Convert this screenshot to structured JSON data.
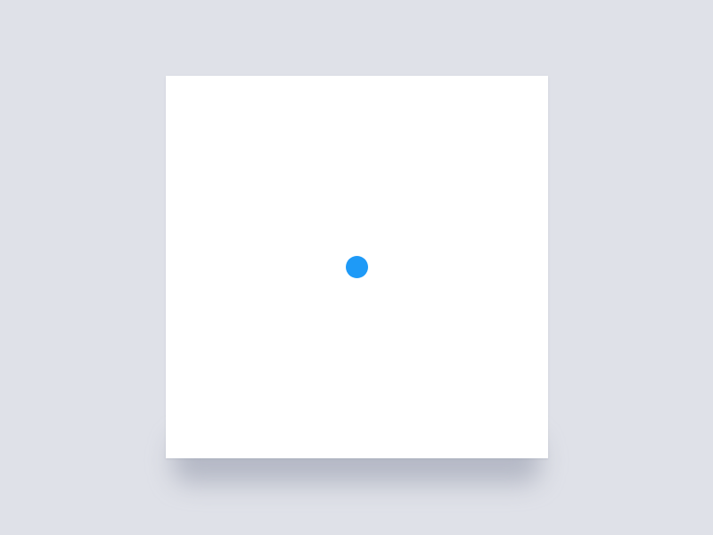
{
  "colors": {
    "background": "#dfe1e8",
    "card": "#ffffff",
    "accent": "#1e9af7"
  },
  "card": {
    "icon": "blue-dot-icon"
  }
}
